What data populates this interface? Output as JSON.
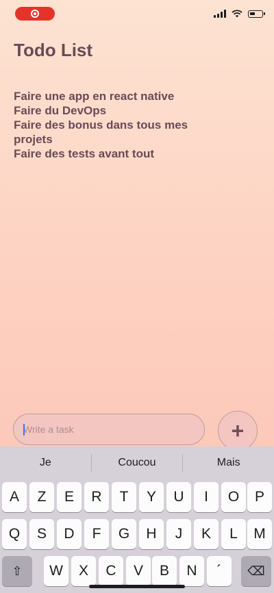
{
  "status_bar": {
    "record_icon": "record-indicator-icon",
    "signal_icon": "cellular-signal-icon",
    "wifi_icon": "wifi-icon",
    "battery_icon": "battery-icon"
  },
  "header": {
    "title": "Todo List"
  },
  "tasks": [
    "Faire une app en react native",
    "Faire du DevOps",
    "Faire des bonus dans tous mes projets",
    "Faire des tests avant tout"
  ],
  "composer": {
    "placeholder": "Write a task",
    "add_label": "+"
  },
  "keyboard": {
    "suggestions": [
      "Je",
      "Coucou",
      "Mais"
    ],
    "row1": [
      "A",
      "Z",
      "E",
      "R",
      "T",
      "Y",
      "U",
      "I",
      "O",
      "P"
    ],
    "row2": [
      "Q",
      "S",
      "D",
      "F",
      "G",
      "H",
      "J",
      "K",
      "L",
      "M"
    ],
    "row3": [
      "W",
      "X",
      "C",
      "V",
      "B",
      "N",
      "´"
    ],
    "shift_label": "⇧",
    "delete_label": "⌫"
  },
  "colors": {
    "accent_red": "#e5332a",
    "text": "#6a4a57",
    "caret": "#3478f6"
  }
}
